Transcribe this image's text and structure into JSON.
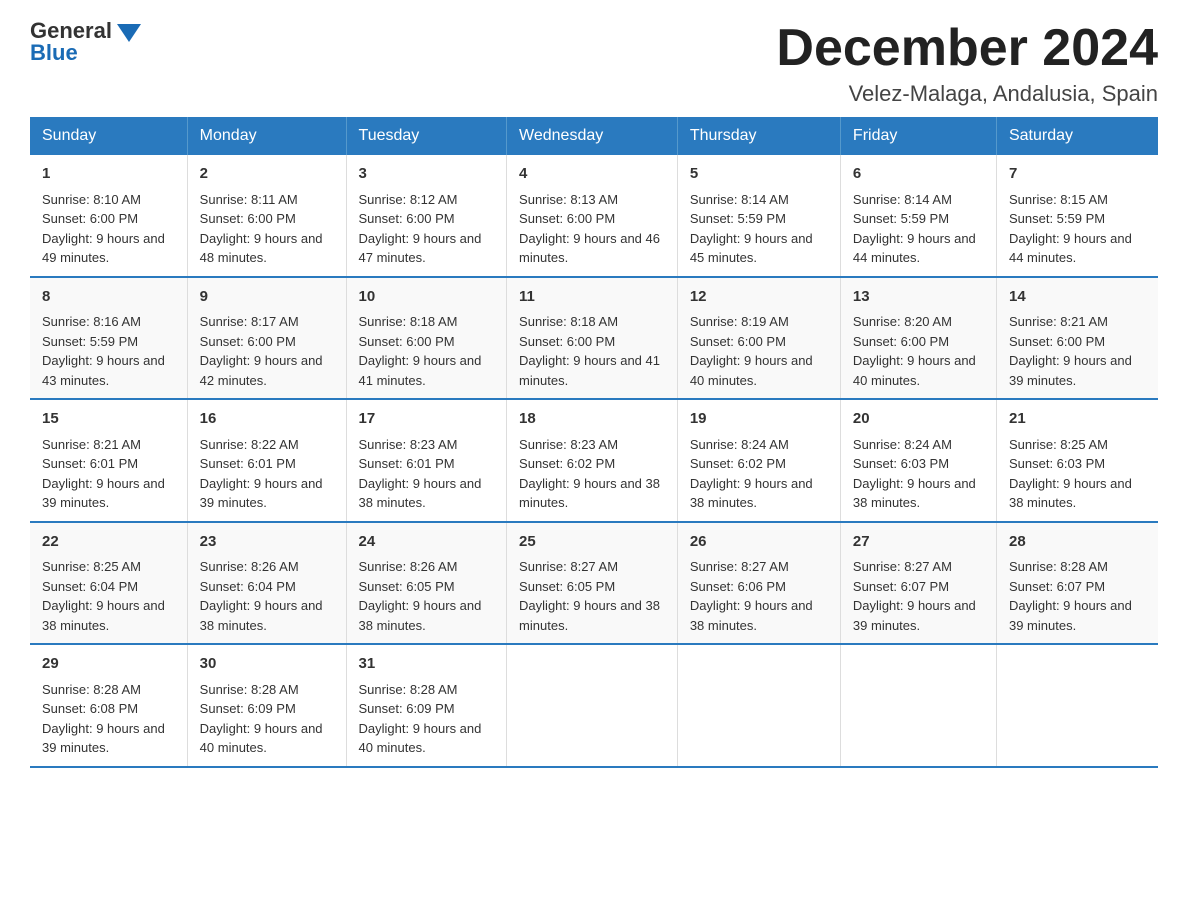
{
  "logo": {
    "general": "General",
    "blue": "Blue"
  },
  "title": "December 2024",
  "subtitle": "Velez-Malaga, Andalusia, Spain",
  "days_of_week": [
    "Sunday",
    "Monday",
    "Tuesday",
    "Wednesday",
    "Thursday",
    "Friday",
    "Saturday"
  ],
  "weeks": [
    [
      {
        "date": "1",
        "sunrise": "8:10 AM",
        "sunset": "6:00 PM",
        "daylight": "9 hours and 49 minutes."
      },
      {
        "date": "2",
        "sunrise": "8:11 AM",
        "sunset": "6:00 PM",
        "daylight": "9 hours and 48 minutes."
      },
      {
        "date": "3",
        "sunrise": "8:12 AM",
        "sunset": "6:00 PM",
        "daylight": "9 hours and 47 minutes."
      },
      {
        "date": "4",
        "sunrise": "8:13 AM",
        "sunset": "6:00 PM",
        "daylight": "9 hours and 46 minutes."
      },
      {
        "date": "5",
        "sunrise": "8:14 AM",
        "sunset": "5:59 PM",
        "daylight": "9 hours and 45 minutes."
      },
      {
        "date": "6",
        "sunrise": "8:14 AM",
        "sunset": "5:59 PM",
        "daylight": "9 hours and 44 minutes."
      },
      {
        "date": "7",
        "sunrise": "8:15 AM",
        "sunset": "5:59 PM",
        "daylight": "9 hours and 44 minutes."
      }
    ],
    [
      {
        "date": "8",
        "sunrise": "8:16 AM",
        "sunset": "5:59 PM",
        "daylight": "9 hours and 43 minutes."
      },
      {
        "date": "9",
        "sunrise": "8:17 AM",
        "sunset": "6:00 PM",
        "daylight": "9 hours and 42 minutes."
      },
      {
        "date": "10",
        "sunrise": "8:18 AM",
        "sunset": "6:00 PM",
        "daylight": "9 hours and 41 minutes."
      },
      {
        "date": "11",
        "sunrise": "8:18 AM",
        "sunset": "6:00 PM",
        "daylight": "9 hours and 41 minutes."
      },
      {
        "date": "12",
        "sunrise": "8:19 AM",
        "sunset": "6:00 PM",
        "daylight": "9 hours and 40 minutes."
      },
      {
        "date": "13",
        "sunrise": "8:20 AM",
        "sunset": "6:00 PM",
        "daylight": "9 hours and 40 minutes."
      },
      {
        "date": "14",
        "sunrise": "8:21 AM",
        "sunset": "6:00 PM",
        "daylight": "9 hours and 39 minutes."
      }
    ],
    [
      {
        "date": "15",
        "sunrise": "8:21 AM",
        "sunset": "6:01 PM",
        "daylight": "9 hours and 39 minutes."
      },
      {
        "date": "16",
        "sunrise": "8:22 AM",
        "sunset": "6:01 PM",
        "daylight": "9 hours and 39 minutes."
      },
      {
        "date": "17",
        "sunrise": "8:23 AM",
        "sunset": "6:01 PM",
        "daylight": "9 hours and 38 minutes."
      },
      {
        "date": "18",
        "sunrise": "8:23 AM",
        "sunset": "6:02 PM",
        "daylight": "9 hours and 38 minutes."
      },
      {
        "date": "19",
        "sunrise": "8:24 AM",
        "sunset": "6:02 PM",
        "daylight": "9 hours and 38 minutes."
      },
      {
        "date": "20",
        "sunrise": "8:24 AM",
        "sunset": "6:03 PM",
        "daylight": "9 hours and 38 minutes."
      },
      {
        "date": "21",
        "sunrise": "8:25 AM",
        "sunset": "6:03 PM",
        "daylight": "9 hours and 38 minutes."
      }
    ],
    [
      {
        "date": "22",
        "sunrise": "8:25 AM",
        "sunset": "6:04 PM",
        "daylight": "9 hours and 38 minutes."
      },
      {
        "date": "23",
        "sunrise": "8:26 AM",
        "sunset": "6:04 PM",
        "daylight": "9 hours and 38 minutes."
      },
      {
        "date": "24",
        "sunrise": "8:26 AM",
        "sunset": "6:05 PM",
        "daylight": "9 hours and 38 minutes."
      },
      {
        "date": "25",
        "sunrise": "8:27 AM",
        "sunset": "6:05 PM",
        "daylight": "9 hours and 38 minutes."
      },
      {
        "date": "26",
        "sunrise": "8:27 AM",
        "sunset": "6:06 PM",
        "daylight": "9 hours and 38 minutes."
      },
      {
        "date": "27",
        "sunrise": "8:27 AM",
        "sunset": "6:07 PM",
        "daylight": "9 hours and 39 minutes."
      },
      {
        "date": "28",
        "sunrise": "8:28 AM",
        "sunset": "6:07 PM",
        "daylight": "9 hours and 39 minutes."
      }
    ],
    [
      {
        "date": "29",
        "sunrise": "8:28 AM",
        "sunset": "6:08 PM",
        "daylight": "9 hours and 39 minutes."
      },
      {
        "date": "30",
        "sunrise": "8:28 AM",
        "sunset": "6:09 PM",
        "daylight": "9 hours and 40 minutes."
      },
      {
        "date": "31",
        "sunrise": "8:28 AM",
        "sunset": "6:09 PM",
        "daylight": "9 hours and 40 minutes."
      },
      null,
      null,
      null,
      null
    ]
  ],
  "labels": {
    "sunrise": "Sunrise:",
    "sunset": "Sunset:",
    "daylight": "Daylight:"
  }
}
